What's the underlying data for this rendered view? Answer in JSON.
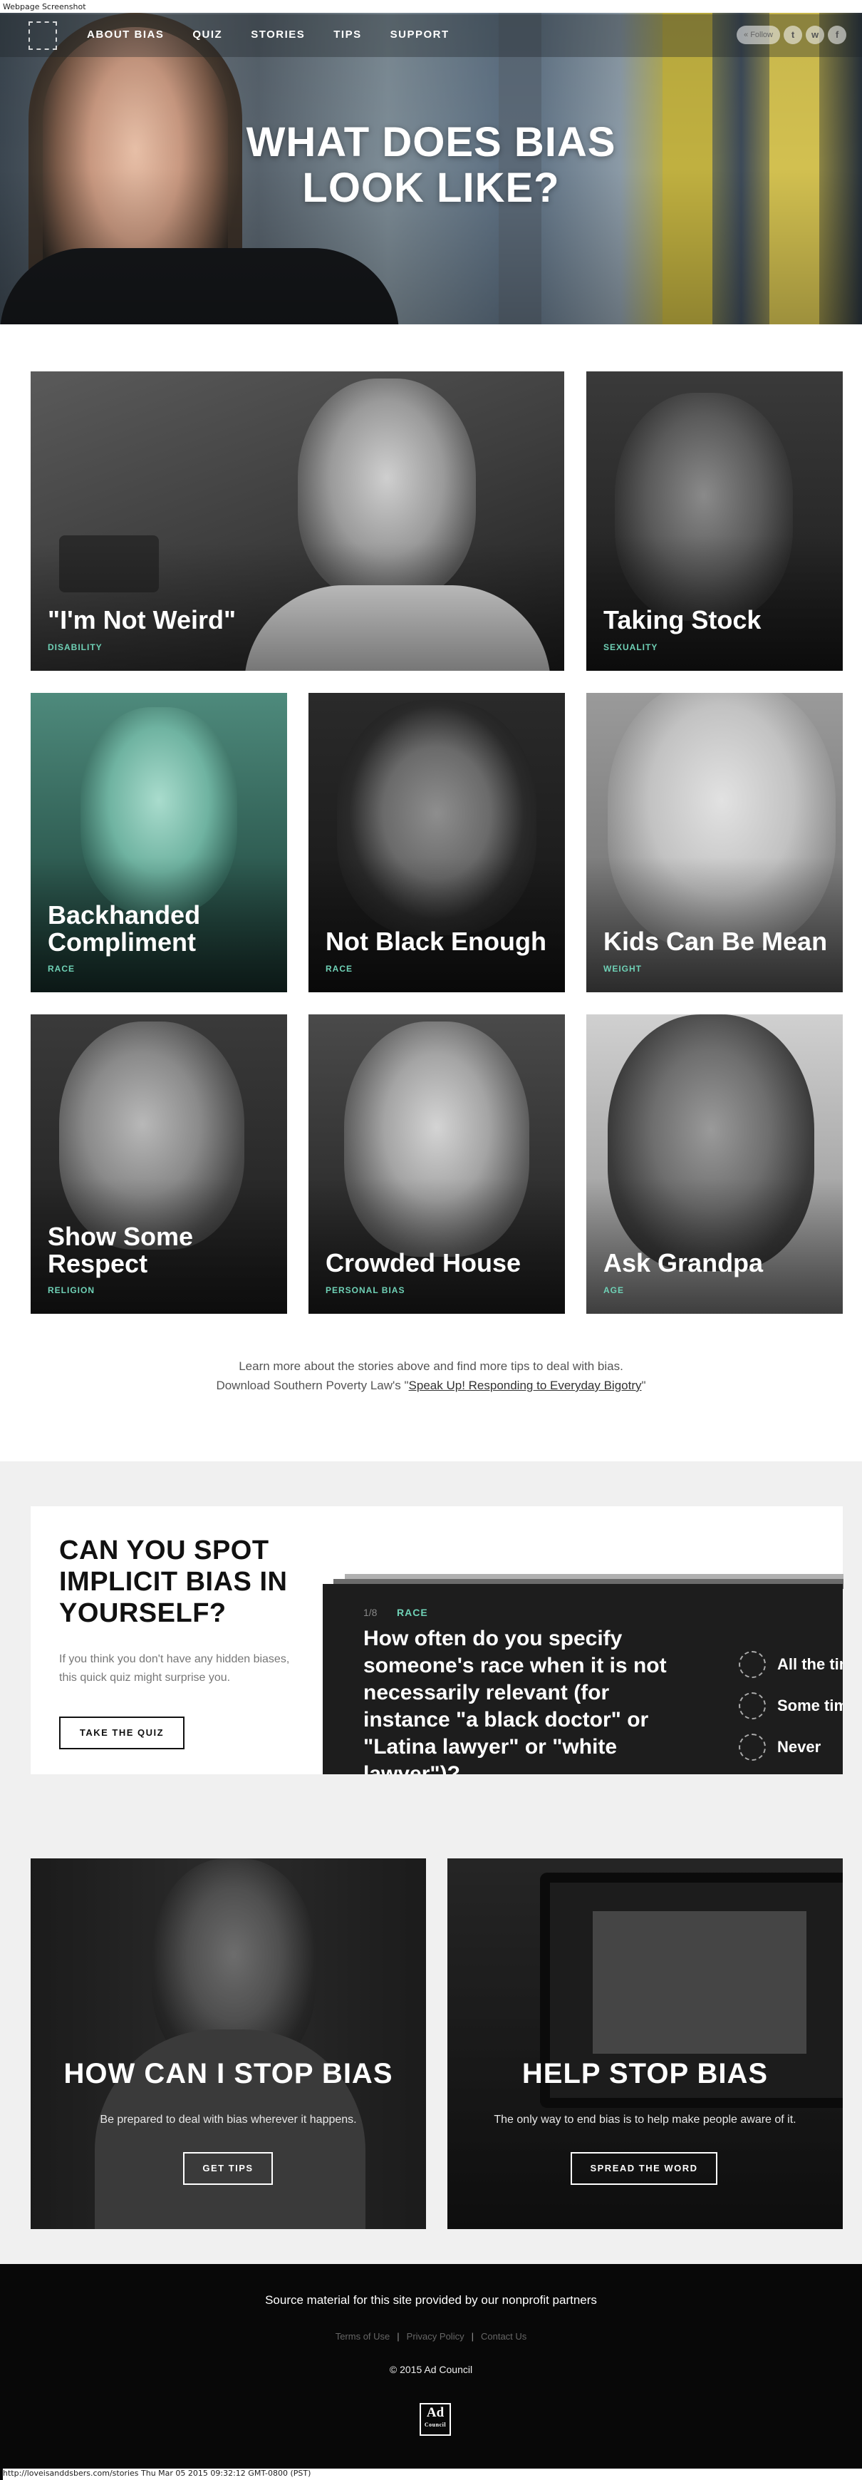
{
  "window_title": "Webpage Screenshot",
  "nav": {
    "items": [
      "ABOUT BIAS",
      "QUIZ",
      "STORIES",
      "TIPS",
      "SUPPORT"
    ],
    "follow_label": "Follow",
    "social": [
      "t",
      "w",
      "f"
    ]
  },
  "hero": {
    "line1": "WHAT DOES BIAS",
    "line2": "LOOK LIKE?"
  },
  "stories": [
    {
      "title": "\"I'm Not Weird\"",
      "tag": "DISABILITY"
    },
    {
      "title": "Taking Stock",
      "tag": "SEXUALITY"
    },
    {
      "title": "Backhanded Compliment",
      "tag": "RACE"
    },
    {
      "title": "Not Black Enough",
      "tag": "RACE"
    },
    {
      "title": "Kids Can Be Mean",
      "tag": "WEIGHT"
    },
    {
      "title": "Show Some Respect",
      "tag": "RELIGION"
    },
    {
      "title": "Crowded House",
      "tag": "PERSONAL BIAS"
    },
    {
      "title": "Ask Grandpa",
      "tag": "AGE"
    }
  ],
  "intro": {
    "line1": "Learn more about the stories above and find more tips to deal with bias.",
    "line2_prefix": "Download Southern Poverty Law's \"",
    "link": "Speak Up! Responding to Everyday Bigotry",
    "line2_suffix": "\""
  },
  "quiz": {
    "title": "CAN YOU SPOT IMPLICIT BIAS IN YOURSELF?",
    "subtitle": "If you think you don't have any hidden biases, this quick quiz might surprise you.",
    "button": "TAKE THE QUIZ",
    "counter": "1/8",
    "category": "RACE",
    "question": "How often do you specify someone's race when it is not necessarily relevant (for instance \"a black doctor\" or \"Latina lawyer\" or \"white lawyer\")?",
    "options": [
      "All the time",
      "Some times",
      "Never"
    ]
  },
  "cta": [
    {
      "title": "HOW CAN I STOP BIAS",
      "subtitle": "Be prepared to deal with bias wherever it happens.",
      "button": "GET TIPS"
    },
    {
      "title": "HELP STOP BIAS",
      "subtitle": "The only way to end bias is to help make people aware of it.",
      "button": "SPREAD THE WORD"
    }
  ],
  "footer": {
    "main": "Source material for this site provided by our nonprofit partners",
    "links": [
      "Terms of Use",
      "Privacy Policy",
      "Contact Us"
    ],
    "copyright": "© 2015 Ad Council",
    "logo_line1": "Ad",
    "logo_line2": "Council"
  },
  "status_bar": "http://loveisanddsbers.com/stories Thu Mar 05 2015 09:32:12 GMT-0800 (PST)",
  "colors": {
    "accent": "#6fd1b6",
    "footer_bg": "#080808",
    "quiz_panel": "#1d1d1d"
  }
}
